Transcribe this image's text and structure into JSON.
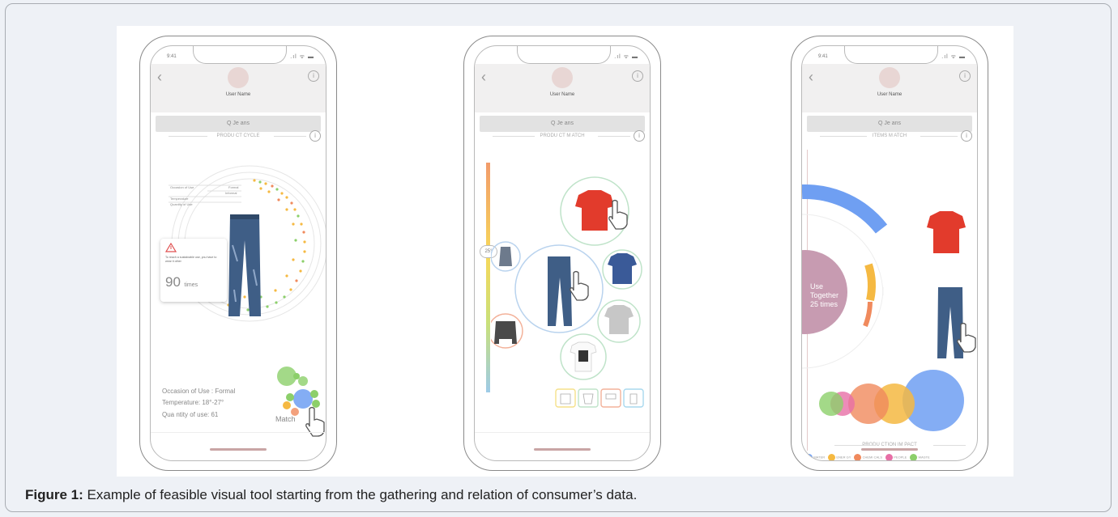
{
  "caption": {
    "label": "Figure 1:",
    "text": " Example of feasible visual tool starting from the gathering and relation of consumer’s data."
  },
  "phones": [
    {
      "time": "9:41",
      "username": "User Name",
      "search": "Q  Je ans",
      "section": "PRODU CT CYCLE",
      "legend": [
        "Occasion of Use",
        "Formal",
        "Informal",
        "Temperature",
        "Quantity of Use"
      ],
      "alert": {
        "text": "To reach a sustainable use, you have to wear it other",
        "count": "90",
        "unit": "times"
      },
      "details": [
        "Occasion  of Use : Formal",
        "Temperature: 18°-27°",
        "Qua ntity  of use: 61"
      ],
      "match_label": "Match"
    },
    {
      "time": "",
      "username": "User Name",
      "search": "Q  Je ans",
      "section": "PRODU CT M ATCH",
      "slider_value": "25°"
    },
    {
      "time": "9:41",
      "username": "User Name",
      "search": "Q  Je ans",
      "section": "ITEMS M  ATCH",
      "use_together": "Use Together 25 times",
      "impact_title": "PRODU CTION IM  PACT",
      "impact_legend": [
        {
          "label": "WATER",
          "color": "#6f9ff2"
        },
        {
          "label": "ENER GY",
          "color": "#f5b942"
        },
        {
          "label": "CHEMI CALS",
          "color": "#f08a5d"
        },
        {
          "label": "PEOPLE",
          "color": "#e76fa6"
        },
        {
          "label": "WASTE",
          "color": "#8ccf6a"
        }
      ]
    }
  ],
  "colors": {
    "jeans": "#3f5e86",
    "shirt_red": "#e23b2c",
    "tee_blue": "#3a5a98"
  }
}
